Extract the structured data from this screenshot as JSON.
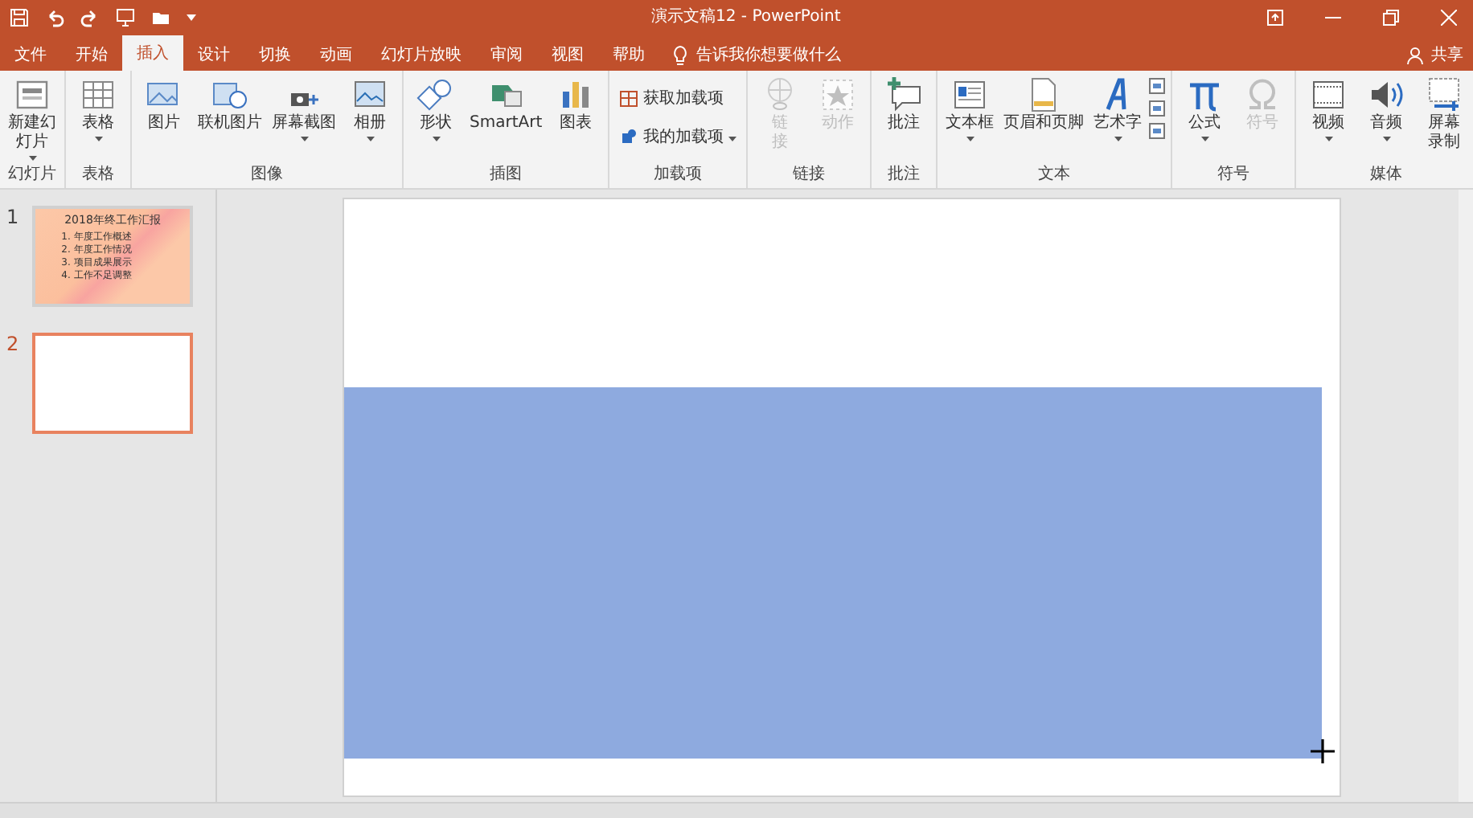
{
  "window": {
    "title": "演示文稿12  -  PowerPoint"
  },
  "tabs": [
    {
      "label": "文件",
      "selected": false
    },
    {
      "label": "开始",
      "selected": false
    },
    {
      "label": "插入",
      "selected": true
    },
    {
      "label": "设计",
      "selected": false
    },
    {
      "label": "切换",
      "selected": false
    },
    {
      "label": "动画",
      "selected": false
    },
    {
      "label": "幻灯片放映",
      "selected": false
    },
    {
      "label": "审阅",
      "selected": false
    },
    {
      "label": "视图",
      "selected": false
    },
    {
      "label": "帮助",
      "selected": false
    }
  ],
  "tell_me": {
    "placeholder": "告诉我你想要做什么"
  },
  "share": {
    "label": "共享"
  },
  "ribbon": {
    "groups": [
      {
        "label": "幻灯片",
        "items": [
          {
            "kind": "tall",
            "label": "新建幻灯片",
            "disabled": false,
            "dropdown": true
          }
        ]
      },
      {
        "label": "表格",
        "items": [
          {
            "kind": "large",
            "label": "表格",
            "disabled": false,
            "dropdown": true
          }
        ]
      },
      {
        "label": "图像",
        "items": [
          {
            "kind": "large",
            "label": "图片",
            "disabled": false,
            "dropdown": false
          },
          {
            "kind": "large",
            "label": "联机图片",
            "disabled": false,
            "dropdown": false
          },
          {
            "kind": "large",
            "label": "屏幕截图",
            "disabled": false,
            "dropdown": true
          },
          {
            "kind": "large",
            "label": "相册",
            "disabled": false,
            "dropdown": true
          }
        ]
      },
      {
        "label": "插图",
        "items": [
          {
            "kind": "large",
            "label": "形状",
            "disabled": false,
            "dropdown": true
          },
          {
            "kind": "large",
            "label": "SmartArt",
            "disabled": false,
            "dropdown": false
          },
          {
            "kind": "large",
            "label": "图表",
            "disabled": false,
            "dropdown": false
          }
        ]
      },
      {
        "label": "加载项",
        "items": [
          {
            "kind": "small",
            "label": "获取加载项",
            "disabled": false,
            "dropdown": false
          },
          {
            "kind": "small",
            "label": "我的加载项",
            "disabled": false,
            "dropdown": true
          }
        ]
      },
      {
        "label": "链接",
        "items": [
          {
            "kind": "tall",
            "label": "链接",
            "disabled": true,
            "dropdown": false
          },
          {
            "kind": "large",
            "label": "动作",
            "disabled": true,
            "dropdown": false
          }
        ]
      },
      {
        "label": "批注",
        "items": [
          {
            "kind": "large",
            "label": "批注",
            "disabled": false,
            "dropdown": false
          }
        ]
      },
      {
        "label": "文本",
        "items": [
          {
            "kind": "large",
            "label": "文本框",
            "disabled": false,
            "dropdown": true
          },
          {
            "kind": "large",
            "label": "页眉和页脚",
            "disabled": false,
            "dropdown": false
          },
          {
            "kind": "large",
            "label": "艺术字",
            "disabled": false,
            "dropdown": true
          },
          {
            "kind": "stack"
          }
        ]
      },
      {
        "label": "符号",
        "items": [
          {
            "kind": "large",
            "label": "公式",
            "disabled": false,
            "dropdown": true
          },
          {
            "kind": "large",
            "label": "符号",
            "disabled": true,
            "dropdown": false
          }
        ]
      },
      {
        "label": "媒体",
        "items": [
          {
            "kind": "large",
            "label": "视频",
            "disabled": false,
            "dropdown": true
          },
          {
            "kind": "large",
            "label": "音频",
            "disabled": false,
            "dropdown": true
          },
          {
            "kind": "tall",
            "label": "屏幕录制",
            "disabled": false,
            "dropdown": false
          }
        ]
      }
    ]
  },
  "slides": [
    {
      "number": "1",
      "selected": false,
      "title": "2018年终工作汇报",
      "lines": [
        "1. 年度工作概述",
        "2. 年度工作情况",
        "3. 项目成果展示",
        "4. 工作不足调整"
      ]
    },
    {
      "number": "2",
      "selected": true
    }
  ]
}
